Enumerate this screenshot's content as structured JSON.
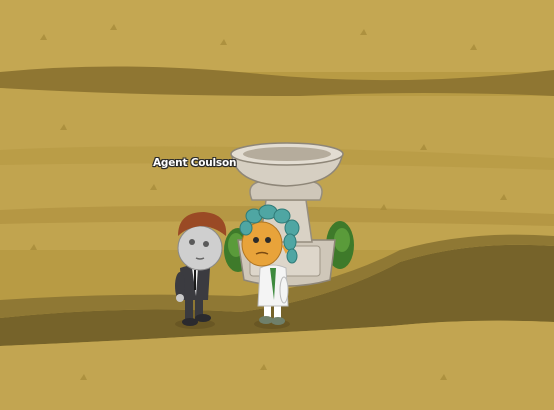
{
  "scene": {
    "name": "grassy-meadow",
    "palette": {
      "grass_light": "#c3a650",
      "grass_mid": "#b09440",
      "grass_dark": "#8d7530",
      "path": "#6b5a22",
      "stone": "#d8d1c5",
      "stone_shadow": "#aea594",
      "bush": "#3e7a2a"
    }
  },
  "characters": [
    {
      "name_label": "Agent Coulson",
      "role": "player-avatar"
    },
    {
      "name_label": "",
      "role": "npc-avatar"
    }
  ],
  "objects": [
    {
      "icon": "stone-birdbath-fountain"
    }
  ]
}
